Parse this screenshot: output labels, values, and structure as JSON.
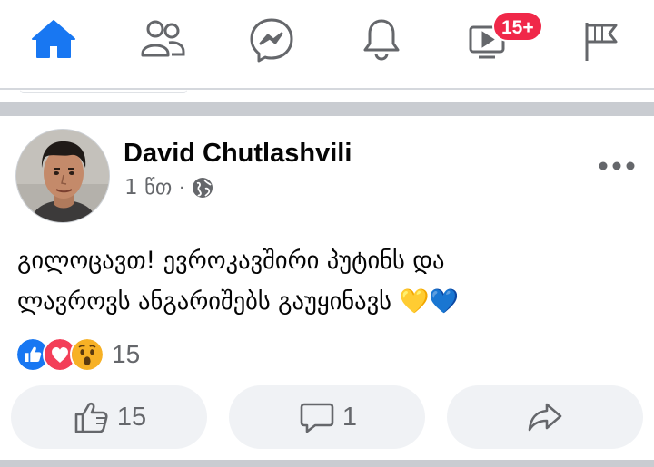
{
  "nav": {
    "items": [
      {
        "name": "home",
        "icon": "home-icon",
        "active": true
      },
      {
        "name": "friends",
        "icon": "friends-icon",
        "active": false
      },
      {
        "name": "messenger",
        "icon": "messenger-icon",
        "active": false
      },
      {
        "name": "notifications",
        "icon": "bell-icon",
        "active": false
      },
      {
        "name": "watch",
        "icon": "video-icon",
        "active": false
      },
      {
        "name": "pages",
        "icon": "flag-icon",
        "active": false
      }
    ],
    "watch_badge": "15+"
  },
  "colors": {
    "accent": "#1877f2",
    "icon_gray": "#65676b",
    "badge": "#f02849",
    "divider": "#c9ccd1",
    "button_bg": "#f0f2f5"
  },
  "post": {
    "author": "David Chutlashvili",
    "time": "1 წთ",
    "separator": "·",
    "privacy_icon": "globe-icon",
    "text_line1": "გილოცავთ! ევროკავშირი პუტინს და",
    "text_line2": "ლავროვს ანგარიშებს გაუყინავს 💛💙",
    "reactions": {
      "icons": [
        "like-icon",
        "love-icon",
        "wow-icon"
      ],
      "count": "15"
    },
    "actions": {
      "like_count": "15",
      "comment_count": "1"
    }
  }
}
